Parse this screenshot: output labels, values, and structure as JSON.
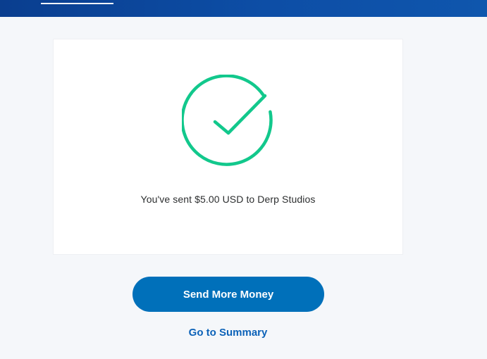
{
  "colors": {
    "header_start": "#0a3e8f",
    "header_end": "#0f56ad",
    "success_green": "#12c88c",
    "primary_button": "#0070ba",
    "link": "#0c62b8",
    "page_background": "#f5f7fa",
    "card_background": "#ffffff"
  },
  "icons": {
    "success": "checkmark-circle-icon"
  },
  "confirmation": {
    "message": "You've sent $5.00 USD to Derp Studios"
  },
  "actions": {
    "send_more_label": "Send More Money",
    "summary_link_label": "Go to Summary"
  }
}
